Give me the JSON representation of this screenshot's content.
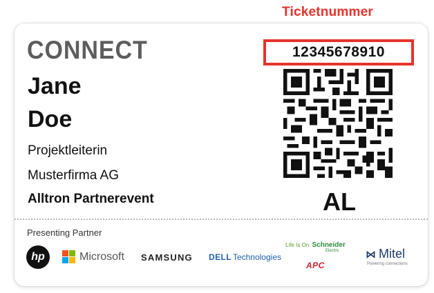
{
  "ticket_label": "Ticketnummer",
  "badge": {
    "logo_text": "CONNECT",
    "first_name": "Jane",
    "last_name": "Doe",
    "role": "Projektleiterin",
    "company": "Musterfirma AG",
    "event": "Alltron Partnerevent",
    "ticket_number": "12345678910",
    "code": "AL"
  },
  "partners": {
    "label": "Presenting Partner",
    "hp": "hp",
    "microsoft": "Microsoft",
    "samsung": "SAMSUNG",
    "dell_brand": "DELL",
    "dell_suffix": "Technologies",
    "schneider_tagline": "Life Is On",
    "schneider_name": "Schneider",
    "schneider_sub": "Electric",
    "apc": "APC",
    "mitel_mark": "⋈",
    "mitel": "Mitel",
    "mitel_tagline": "Powering connections"
  },
  "colors": {
    "accent_red": "#e8322b",
    "logo_gray": "#5d5d5d"
  }
}
